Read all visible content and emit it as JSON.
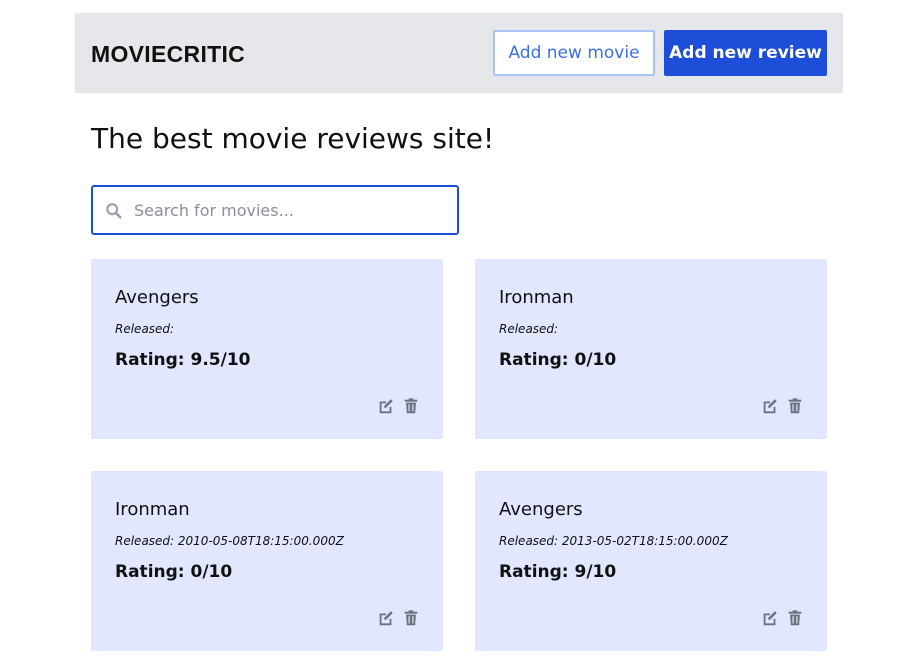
{
  "header": {
    "brand": "MOVIECRITIC",
    "add_movie_label": "Add new movie",
    "add_review_label": "Add new review"
  },
  "main": {
    "title": "The best movie reviews site!",
    "search": {
      "placeholder": "Search for movies...",
      "value": ""
    }
  },
  "icons": {
    "search": "search-icon",
    "edit": "edit-icon",
    "delete": "trash-icon"
  },
  "colors": {
    "header_bg": "#e5e7eb",
    "accent": "#1d4ed8",
    "card_bg": "#e0e7ff",
    "icon": "#6b7280"
  },
  "movies": [
    {
      "title": "Avengers",
      "released": "Released:",
      "rating": "Rating: 9.5/10"
    },
    {
      "title": "Ironman",
      "released": "Released:",
      "rating": "Rating: 0/10"
    },
    {
      "title": "Ironman",
      "released": "Released: 2010-05-08T18:15:00.000Z",
      "rating": "Rating: 0/10"
    },
    {
      "title": "Avengers",
      "released": "Released: 2013-05-02T18:15:00.000Z",
      "rating": "Rating: 9/10"
    }
  ]
}
